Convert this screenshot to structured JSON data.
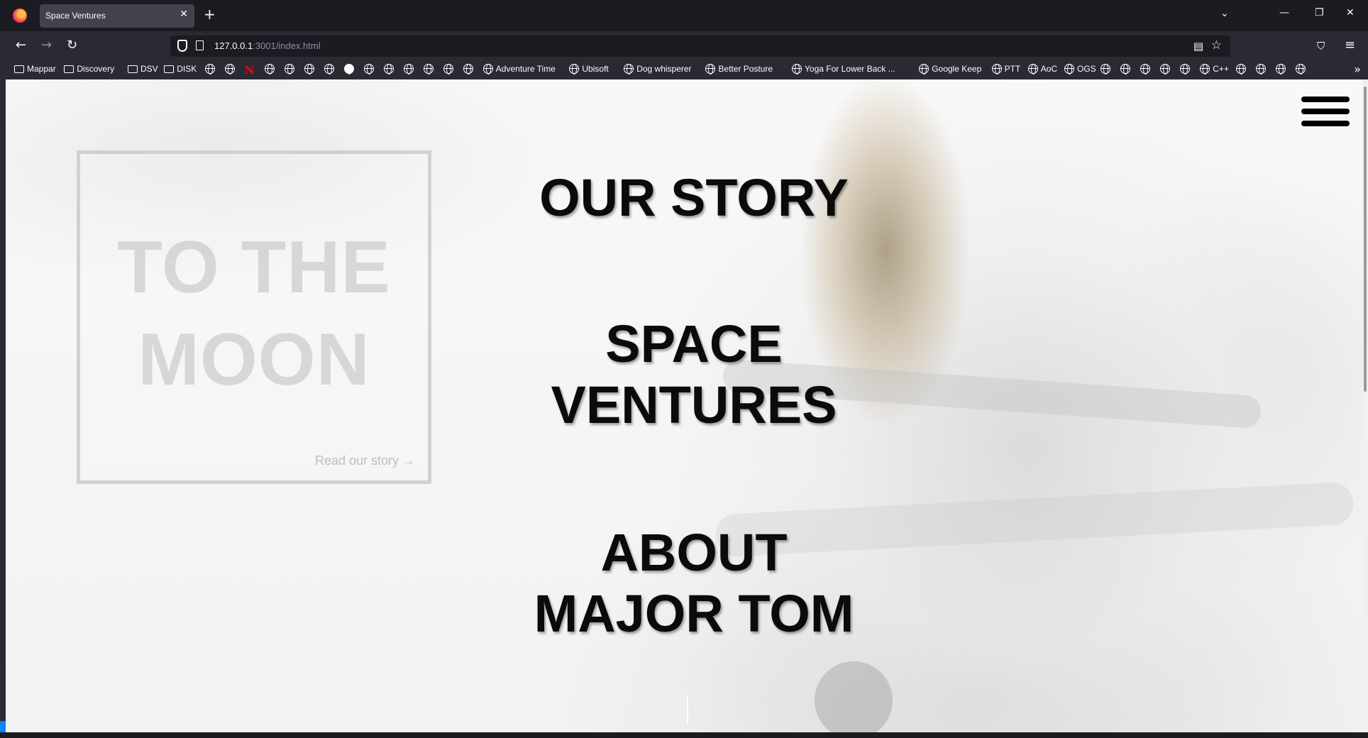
{
  "browser": {
    "tab_title": "Space Ventures",
    "url_host": "127.0.0.1",
    "url_rest": ":3001/index.html"
  },
  "bookmarks": [
    {
      "type": "folder",
      "label": "Mappar"
    },
    {
      "type": "folder",
      "label": "Discovery"
    },
    {
      "type": "folder",
      "label": "DSV"
    },
    {
      "type": "folder",
      "label": "DISK"
    },
    {
      "type": "globe",
      "label": ""
    },
    {
      "type": "globe",
      "label": ""
    },
    {
      "type": "netflix",
      "label": ""
    },
    {
      "type": "globe",
      "label": ""
    },
    {
      "type": "globe",
      "label": ""
    },
    {
      "type": "globe",
      "label": ""
    },
    {
      "type": "globe",
      "label": ""
    },
    {
      "type": "github",
      "label": ""
    },
    {
      "type": "globe",
      "label": ""
    },
    {
      "type": "globe",
      "label": ""
    },
    {
      "type": "globe",
      "label": ""
    },
    {
      "type": "globe",
      "label": ""
    },
    {
      "type": "globe",
      "label": ""
    },
    {
      "type": "globe",
      "label": ""
    },
    {
      "type": "globe",
      "label": "Adventure Time"
    },
    {
      "type": "globe",
      "label": "Ubisoft"
    },
    {
      "type": "globe",
      "label": "Dog whisperer"
    },
    {
      "type": "globe",
      "label": "Better Posture"
    },
    {
      "type": "globe",
      "label": "Yoga For Lower Back ..."
    },
    {
      "type": "globe",
      "label": "Google Keep"
    },
    {
      "type": "globe",
      "label": "PTT"
    },
    {
      "type": "globe",
      "label": "AoC"
    },
    {
      "type": "globe",
      "label": "OGS"
    },
    {
      "type": "globe",
      "label": ""
    },
    {
      "type": "globe",
      "label": ""
    },
    {
      "type": "globe",
      "label": ""
    },
    {
      "type": "globe",
      "label": ""
    },
    {
      "type": "globe",
      "label": ""
    },
    {
      "type": "globe",
      "label": "C++"
    },
    {
      "type": "globe",
      "label": ""
    },
    {
      "type": "globe",
      "label": ""
    },
    {
      "type": "globe",
      "label": ""
    },
    {
      "type": "globe",
      "label": ""
    }
  ],
  "page": {
    "card": {
      "title_line1": "TO THE",
      "title_line2": "MOON",
      "link": "Read our story →"
    },
    "menu": {
      "item1": "OUR STORY",
      "item2_line1": "SPACE",
      "item2_line2": "VENTURES",
      "item3_line1": "ABOUT",
      "item3_line2": "MAJOR TOM"
    }
  },
  "icons": {
    "back": "arrow-left-icon",
    "forward": "arrow-right-icon",
    "reload": "reload-icon",
    "menu": "hamburger-icon"
  }
}
